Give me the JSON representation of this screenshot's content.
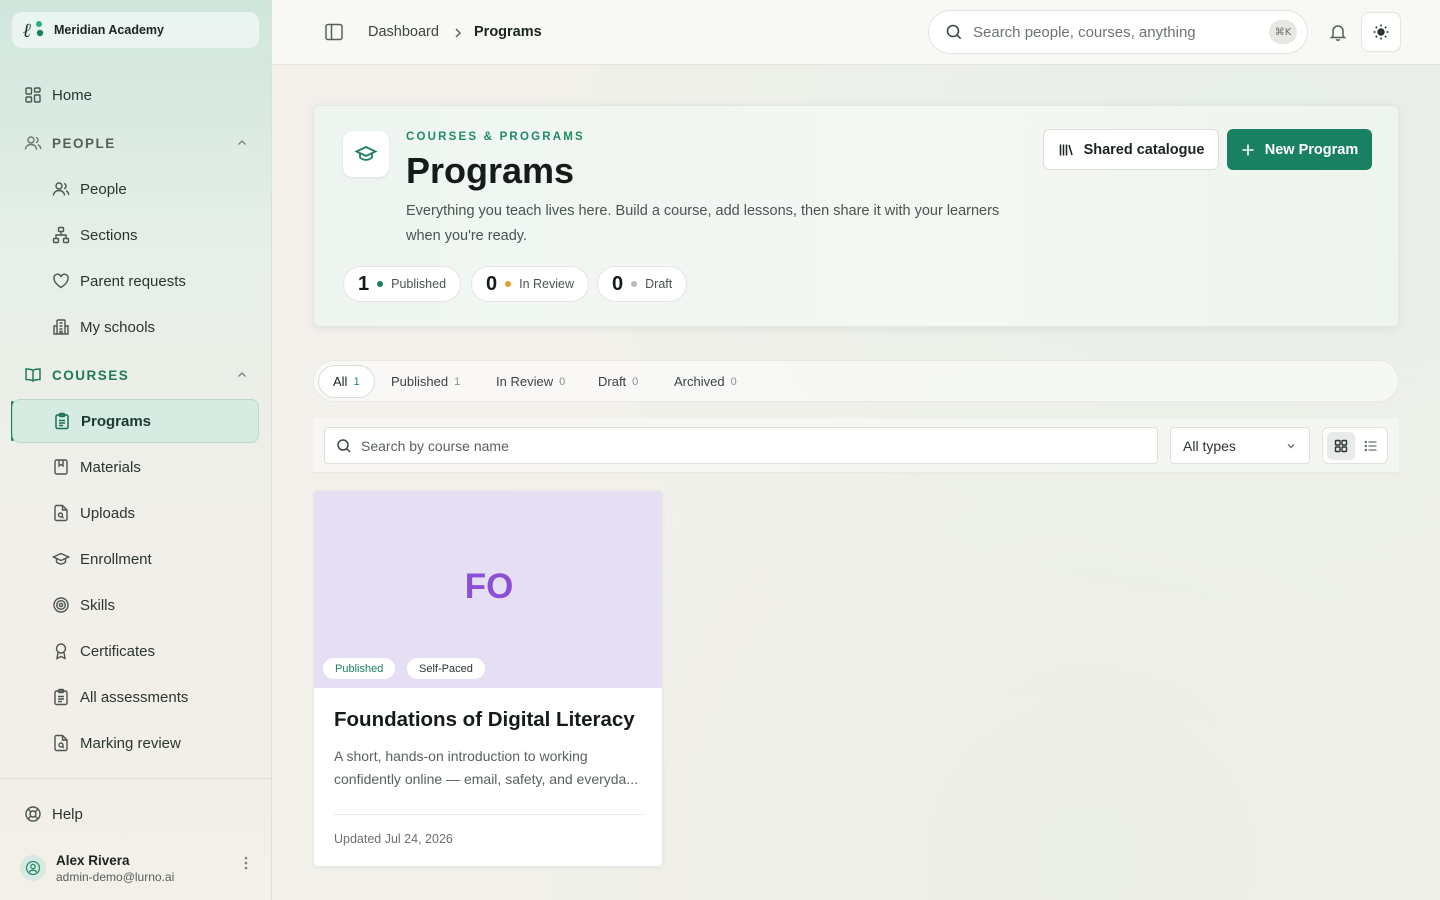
{
  "brand": {
    "name": "Meridian Academy"
  },
  "sidebar": {
    "home": "Home",
    "people_section": "PEOPLE",
    "people_items": [
      "People",
      "Sections",
      "Parent requests",
      "My schools"
    ],
    "courses_section": "COURSES",
    "course_items": [
      "Programs",
      "Materials",
      "Uploads",
      "Enrollment",
      "Skills",
      "Certificates",
      "All assessments",
      "Marking review"
    ],
    "help": "Help",
    "user": {
      "name": "Alex Rivera",
      "email": "admin-demo@lurno.ai"
    }
  },
  "topbar": {
    "breadcrumb": [
      "Dashboard",
      "Programs"
    ],
    "search_placeholder": "Search people, courses, anything",
    "shortcut": "⌘K"
  },
  "hero": {
    "eyebrow": "COURSES & PROGRAMS",
    "title": "Programs",
    "description": "Everything you teach lives here. Build a course, add lessons, then share it with your learners when you're ready.",
    "stats": [
      {
        "count": "1",
        "label": "Published",
        "color": "#1a8062"
      },
      {
        "count": "0",
        "label": "In Review",
        "color": "#e0a030"
      },
      {
        "count": "0",
        "label": "Draft",
        "color": "#b9bdb9"
      }
    ],
    "shared_button": "Shared catalogue",
    "new_button": "New Program"
  },
  "tabs": [
    {
      "label": "All",
      "count": "1"
    },
    {
      "label": "Published",
      "count": "1"
    },
    {
      "label": "In Review",
      "count": "0"
    },
    {
      "label": "Draft",
      "count": "0"
    },
    {
      "label": "Archived",
      "count": "0"
    }
  ],
  "filters": {
    "search_placeholder": "Search by course name",
    "type_select": "All types"
  },
  "courses": [
    {
      "initials": "FO",
      "status": "Published",
      "pace": "Self-Paced",
      "title": "Foundations of Digital Literacy",
      "description": "A short, hands-on introduction to working confidently online — email, safety, and everyda...",
      "updated": "Updated Jul 24, 2026"
    }
  ],
  "colors": {
    "accent": "#1a8062",
    "cover": "#e6dff3",
    "initials": "#8a4fd6"
  }
}
